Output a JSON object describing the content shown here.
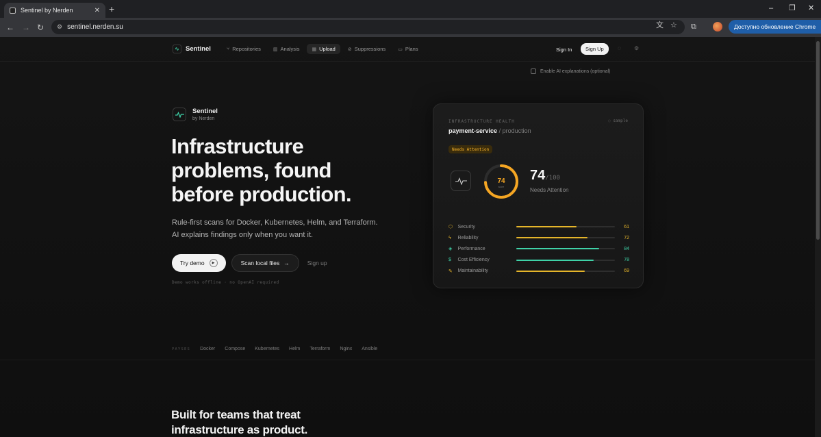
{
  "browser": {
    "tab_title": "Sentinel by Nerden",
    "tab_close": "✕",
    "new_tab": "+",
    "url": "sentinel.nerden.su",
    "update_label": "Доступно обновление Chrome",
    "window_controls": [
      "–",
      "❐",
      "✕"
    ]
  },
  "nav": {
    "brand": "Sentinel",
    "links": [
      {
        "label": "Repositories",
        "icon": "git-branch-icon",
        "glyph": "⑂",
        "active": false
      },
      {
        "label": "Analysis",
        "icon": "bar-chart-icon",
        "glyph": "▥",
        "active": false
      },
      {
        "label": "Upload",
        "icon": "grid-icon",
        "glyph": "▦",
        "active": true
      },
      {
        "label": "Suppressions",
        "icon": "search-icon",
        "glyph": "⊘",
        "active": false
      },
      {
        "label": "Plans",
        "icon": "card-icon",
        "glyph": "▭",
        "active": false
      }
    ],
    "signin": "Sign In",
    "signup": "Sign Up"
  },
  "ai_toggle": {
    "label": "Enable AI explanations (optional)",
    "checked": false
  },
  "hero": {
    "brand_name": "Sentinel",
    "brand_sub": "by Nerden",
    "title_line1": "Infrastructure",
    "title_line2": "problems, found",
    "title_line3": "before production.",
    "subtitle_line1": "Rule-first scans for Docker, Kubernetes, Helm, and Terraform.",
    "subtitle_line2": "AI explains findings only when you want it.",
    "cta_demo": "Try demo",
    "cta_scan": "Scan local files",
    "cta_scan_arrow": "→",
    "cta_signup": "Sign up",
    "note": "Demo works offline · no OpenAI required"
  },
  "card": {
    "label": "INFRASTRUCTURE HEALTH",
    "sample": "sample",
    "service": "payment-service",
    "env": "/ production",
    "badge": "Needs Attention",
    "score": "74",
    "score_max": "/100",
    "score_fraction": 0.74,
    "gauge_caption": "score",
    "status": "Needs Attention",
    "accent": "#f5a623",
    "metrics": [
      {
        "label": "Security",
        "value": 61,
        "color": "#e5b52a",
        "icon": "shield-icon",
        "glyph": "⬡"
      },
      {
        "label": "Reliability",
        "value": 72,
        "color": "#e5b52a",
        "icon": "pulse-icon",
        "glyph": "ϟ"
      },
      {
        "label": "Performance",
        "value": 84,
        "color": "#3fd2a8",
        "icon": "gauge-icon",
        "glyph": "◈"
      },
      {
        "label": "Cost Efficiency",
        "value": 78,
        "color": "#3fd2a8",
        "icon": "dollar-icon",
        "glyph": "$"
      },
      {
        "label": "Maintainability",
        "value": 69,
        "color": "#e5b52a",
        "icon": "wrench-icon",
        "glyph": "✎"
      }
    ]
  },
  "tags": {
    "label": "PAYSES",
    "items": [
      "Docker",
      "Compose",
      "Kubernetes",
      "Helm",
      "Terraform",
      "Nginx",
      "Ansible"
    ]
  },
  "section": {
    "title_line1": "Built for teams that treat",
    "title_line2": "infrastructure as product."
  }
}
